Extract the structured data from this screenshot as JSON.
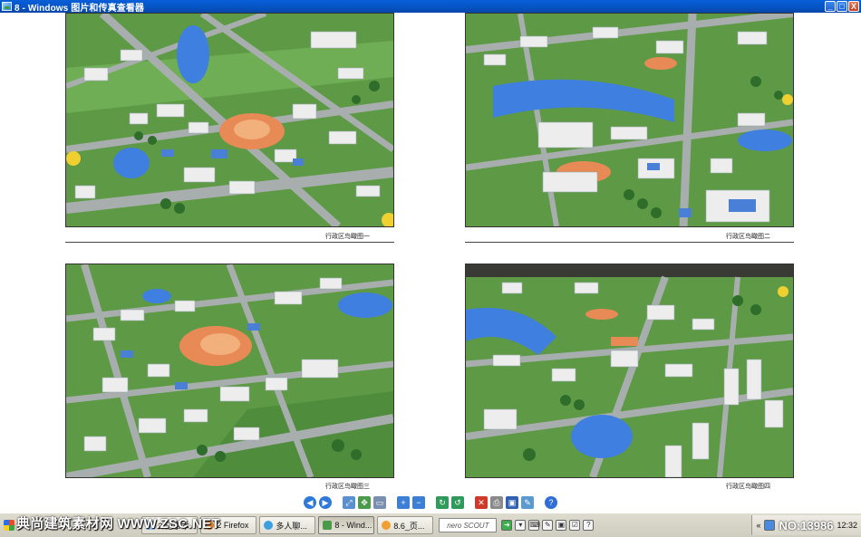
{
  "window": {
    "title": "8 - Windows 图片和传真查看器",
    "buttons": {
      "minimize": "_",
      "maximize": "□",
      "close": "X"
    }
  },
  "document": {
    "captions": [
      "行政区鸟瞰图一",
      "行政区鸟瞰图二",
      "行政区鸟瞰图三",
      "行政区鸟瞰图四"
    ]
  },
  "viewer_toolbar": {
    "icons": [
      "previous-image-icon",
      "next-image-icon",
      "best-fit-icon",
      "actual-size-icon",
      "slideshow-icon",
      "zoom-in-icon",
      "zoom-out-icon",
      "rotate-clockwise-icon",
      "rotate-counterclockwise-icon",
      "delete-icon",
      "print-icon",
      "save-icon",
      "edit-icon",
      "help-icon"
    ]
  },
  "taskbar": {
    "watermark": "典尚建筑素材网 WWW.ZSC.NET",
    "start_label": "M",
    "tasks": [
      {
        "label": "2 记事本",
        "active": false
      },
      {
        "label": "2 Firefox",
        "active": false
      },
      {
        "label": "多人聊...",
        "active": false
      },
      {
        "label": "8 - Wind...",
        "active": true
      },
      {
        "label": "8.6_页...",
        "active": false
      }
    ],
    "search_box": "nero SCOUT",
    "tray_prefix": "«",
    "tray_id": "NO:13986",
    "clock": "12:32"
  },
  "colors": {
    "titlebar": "#0653c4",
    "taskbar": "#d6d3c7",
    "grass": "#5e9a46",
    "road": "#9aa0a0",
    "water": "#3f7fe0",
    "plaza": "#e88a55"
  }
}
